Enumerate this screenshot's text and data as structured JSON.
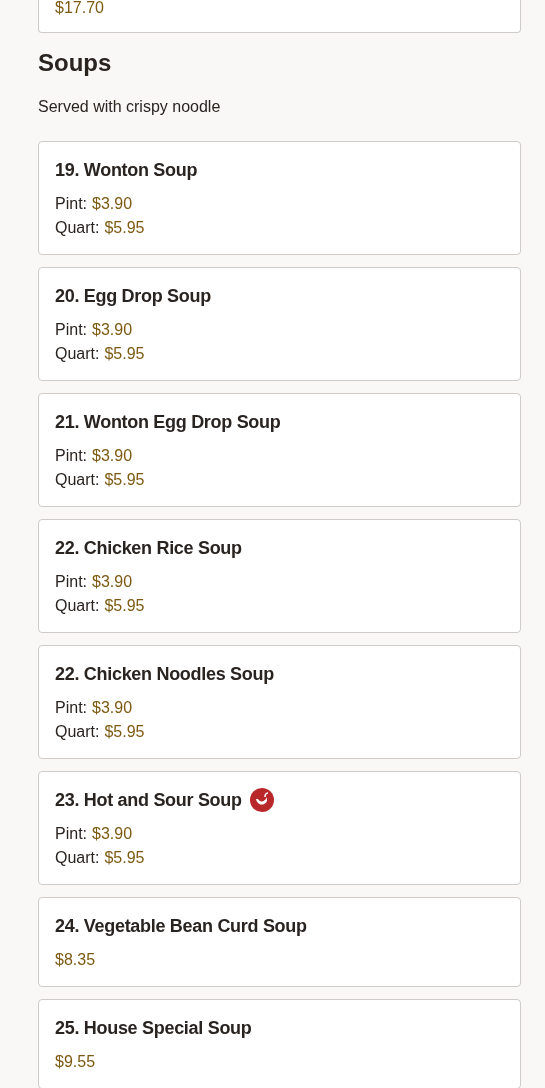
{
  "previous_card": {
    "prices": [
      {
        "amount": "$17.70"
      }
    ]
  },
  "section": {
    "title": "Soups",
    "description": "Served with crispy noodle",
    "items": [
      {
        "name": "19. Wonton Soup",
        "spicy": false,
        "prices": [
          {
            "label": "Pint:",
            "amount": "$3.90"
          },
          {
            "label": "Quart:",
            "amount": "$5.95"
          }
        ]
      },
      {
        "name": "20. Egg Drop Soup",
        "spicy": false,
        "prices": [
          {
            "label": "Pint:",
            "amount": "$3.90"
          },
          {
            "label": "Quart:",
            "amount": "$5.95"
          }
        ]
      },
      {
        "name": "21. Wonton Egg Drop Soup",
        "spicy": false,
        "prices": [
          {
            "label": "Pint:",
            "amount": "$3.90"
          },
          {
            "label": "Quart:",
            "amount": "$5.95"
          }
        ]
      },
      {
        "name": "22. Chicken Rice Soup",
        "spicy": false,
        "prices": [
          {
            "label": "Pint:",
            "amount": "$3.90"
          },
          {
            "label": "Quart:",
            "amount": "$5.95"
          }
        ]
      },
      {
        "name": "22. Chicken Noodles Soup",
        "spicy": false,
        "prices": [
          {
            "label": "Pint:",
            "amount": "$3.90"
          },
          {
            "label": "Quart:",
            "amount": "$5.95"
          }
        ]
      },
      {
        "name": "23. Hot and Sour Soup",
        "spicy": true,
        "prices": [
          {
            "label": "Pint:",
            "amount": "$3.90"
          },
          {
            "label": "Quart:",
            "amount": "$5.95"
          }
        ]
      },
      {
        "name": "24. Vegetable Bean Curd Soup",
        "spicy": false,
        "prices": [
          {
            "amount": "$8.35"
          }
        ]
      },
      {
        "name": "25. House Special Soup",
        "spicy": false,
        "prices": [
          {
            "amount": "$9.55"
          }
        ]
      }
    ]
  }
}
